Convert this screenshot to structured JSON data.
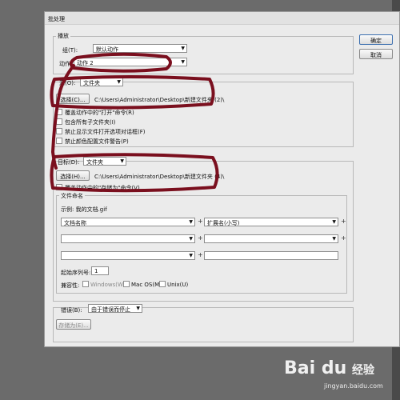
{
  "dialog": {
    "title": "批处理",
    "ok_label": "确定",
    "cancel_label": "取消"
  },
  "play": {
    "legend": "播放",
    "group_label": "组(T):",
    "group_value": "默认动作",
    "action_label": "动作",
    "action_value": "动作 2"
  },
  "source": {
    "label": "源(O):",
    "value": "文件夹",
    "choose_label": "选择(C)...",
    "path": "C:\\Users\\Administrator\\Desktop\\新建文件夹 (2)\\",
    "options": [
      "覆盖动作中的\"打开\"命令(R)",
      "包含所有子文件夹(I)",
      "禁止显示文件打开选项对话框(F)",
      "禁止颜色配置文件警告(P)"
    ]
  },
  "destination": {
    "label": "目标(D):",
    "value": "文件夹",
    "choose_label": "选择(H)...",
    "path": "C:\\Users\\Administrator\\Desktop\\新建文件夹 (4)\\",
    "override_label": "覆盖动作中的\"存储为\"命令(V)",
    "naming": {
      "legend": "文件命名",
      "example": "示例: 我的文档.gif",
      "rows": [
        [
          "文档名称",
          "扩展名(小写)"
        ],
        [
          "",
          ""
        ],
        [
          "",
          ""
        ]
      ],
      "serial_label": "起始序列号:",
      "serial_value": "1",
      "compat_label": "兼容性:",
      "compat_options": [
        "Windows(W)",
        "Mac OS(M)",
        "Unix(U)"
      ]
    }
  },
  "errors": {
    "label": "错误(B):",
    "value": "由于错误而停止",
    "save_as_label": "存储为(E)..."
  },
  "watermark": {
    "logo": "Bai du",
    "brand": "经验",
    "url": "jingyan.baidu.com"
  },
  "colors": {
    "annotation": "#7a0f1e",
    "dialog_bg": "#ebebeb",
    "page_bg": "#6b6b6b"
  }
}
